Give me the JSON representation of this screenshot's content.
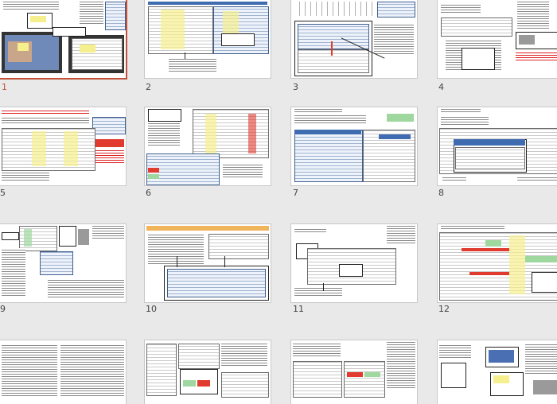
{
  "slides": [
    {
      "number": "1",
      "selected": true
    },
    {
      "number": "2",
      "selected": false
    },
    {
      "number": "3",
      "selected": false
    },
    {
      "number": "4",
      "selected": false
    },
    {
      "number": "5",
      "selected": false
    },
    {
      "number": "6",
      "selected": false
    },
    {
      "number": "7",
      "selected": false
    },
    {
      "number": "8",
      "selected": false
    },
    {
      "number": "9",
      "selected": false
    },
    {
      "number": "10",
      "selected": false
    },
    {
      "number": "11",
      "selected": false
    },
    {
      "number": "12",
      "selected": false
    },
    {
      "number": "",
      "selected": false
    },
    {
      "number": "",
      "selected": false
    },
    {
      "number": "",
      "selected": false
    },
    {
      "number": "",
      "selected": false
    }
  ],
  "colors": {
    "selected_accent": "#c0503a",
    "background": "#e9e9e9"
  }
}
